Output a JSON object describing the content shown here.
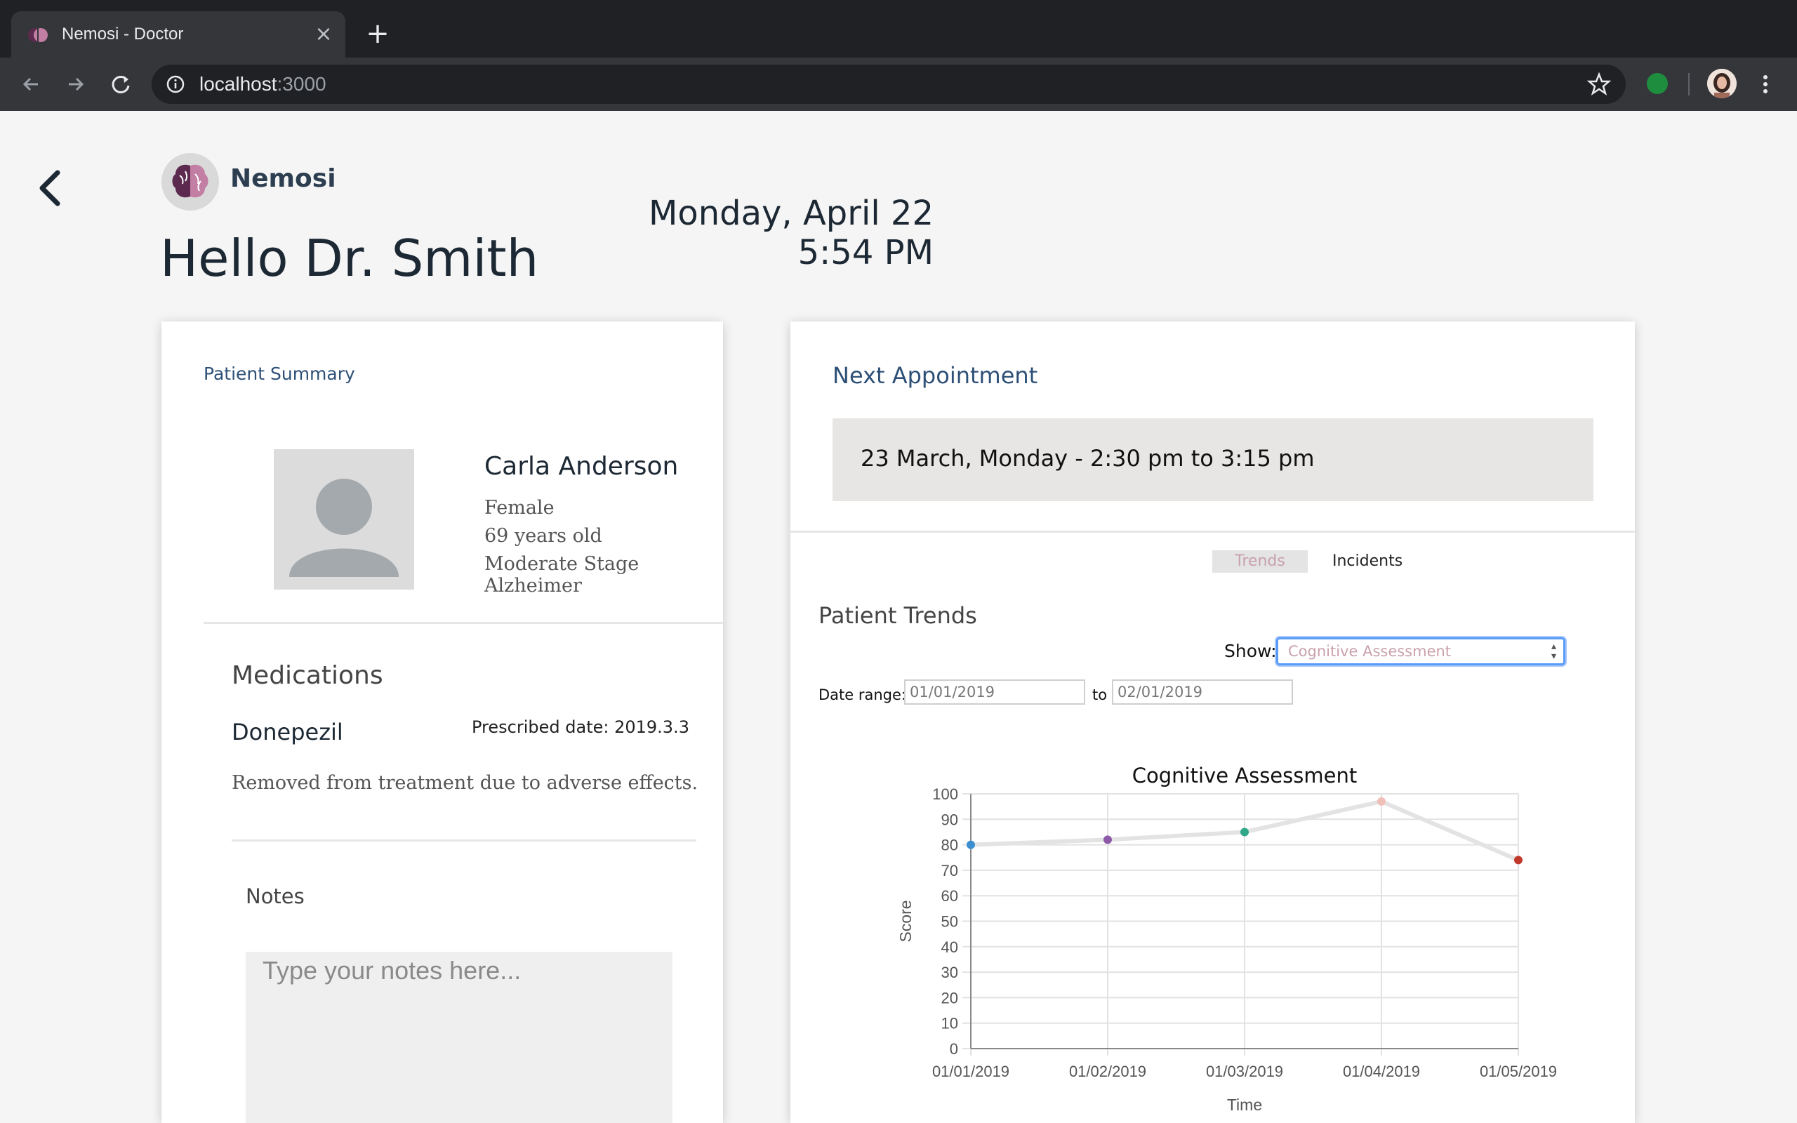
{
  "browser": {
    "tab_title": "Nemosi - Doctor",
    "url_host": "localhost",
    "url_port": ":3000"
  },
  "header": {
    "brand": "Nemosi",
    "greeting": "Hello Dr. Smith",
    "date": "Monday, April 22",
    "time": "5:54 PM"
  },
  "patient_summary": {
    "title": "Patient Summary",
    "name": "Carla Anderson",
    "gender": "Female",
    "age": "69 years old",
    "stage": "Moderate Stage Alzheimer",
    "medications_title": "Medications",
    "medication": {
      "name": "Donepezil",
      "prescribed": "Prescribed date: 2019.3.3",
      "note": "Removed from treatment due to adverse effects."
    },
    "notes_title": "Notes",
    "notes_placeholder": "Type your notes here..."
  },
  "appointment": {
    "title": "Next Appointment",
    "text": "23 March, Monday - 2:30 pm to 3:15 pm"
  },
  "trends": {
    "tabs": [
      "Trends",
      "Incidents"
    ],
    "title": "Patient Trends",
    "show_label": "Show:",
    "show_value": "Cognitive Assessment",
    "range_label": "Date range:",
    "range_to": "to",
    "range_from_value": "01/01/2019",
    "range_to_value": "02/01/2019"
  },
  "colors": {
    "accent_pink": "#c9a1ac",
    "heading_blue": "#2e5077",
    "focus_blue": "#5b9bf8"
  },
  "chart_data": {
    "type": "line",
    "title": "Cognitive Assessment",
    "xlabel": "Time",
    "ylabel": "Score",
    "categories": [
      "01/01/2019",
      "01/02/2019",
      "01/03/2019",
      "01/04/2019",
      "01/05/2019"
    ],
    "values": [
      80,
      82,
      85,
      97,
      74
    ],
    "point_colors": [
      "#3b8fd0",
      "#8e5aa8",
      "#2fa88a",
      "#f0c0b8",
      "#c0392b"
    ],
    "ylim": [
      0,
      100
    ],
    "yticks": [
      0,
      10,
      20,
      30,
      40,
      50,
      60,
      70,
      80,
      90,
      100
    ],
    "grid": true,
    "legend": "none"
  }
}
